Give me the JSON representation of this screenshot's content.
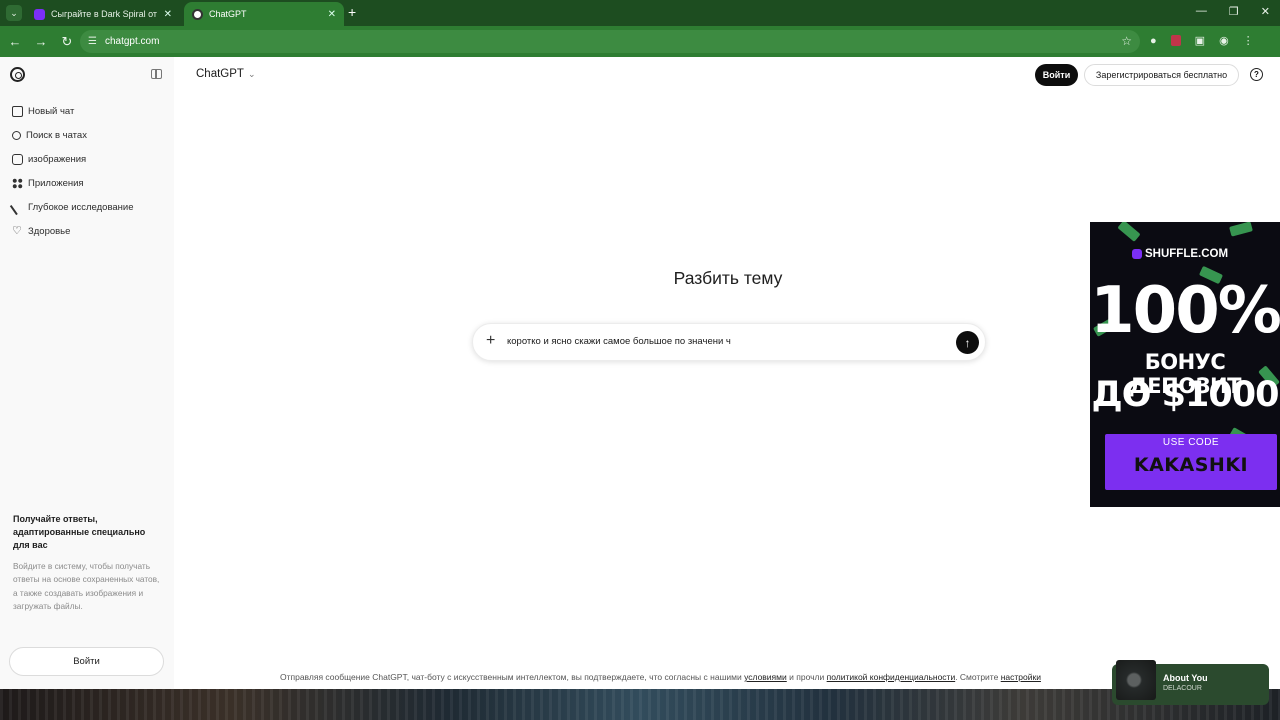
{
  "browser": {
    "tabs": [
      {
        "title": "Сыграйте в Dark Spiral от Hack"
      },
      {
        "title": "ChatGPT"
      }
    ],
    "url": "chatgpt.com"
  },
  "sidebar": {
    "items": [
      {
        "label": "Новый чат",
        "icon": "edit-icon"
      },
      {
        "label": "Поиск в чатах",
        "icon": "search-icon"
      },
      {
        "label": "изображения",
        "icon": "image-icon"
      },
      {
        "label": "Приложения",
        "icon": "apps-icon"
      },
      {
        "label": "Глубокое исследование",
        "icon": "telescope-icon"
      },
      {
        "label": "Здоровье",
        "icon": "heart-icon"
      }
    ],
    "promo_title": "Получайте ответы, адаптированные специально для вас",
    "promo_text": "Войдите в систему, чтобы получать ответы на основе сохраненных чатов, а также создавать изображения и загружать файлы.",
    "login_label": "Войти"
  },
  "header": {
    "brand": "ChatGPT",
    "login_label": "Войти",
    "signup_label": "Зарегистрироваться бесплатно",
    "help": "?"
  },
  "main": {
    "headline": "Разбить тему",
    "prompt_value": "коротко и ясно скажи самое большое по значени ч"
  },
  "footer": {
    "prefix": "Отправляя сообщение ChatGPT, чат-боту с искусственным интеллектом, вы подтверждаете, что согласны с нашими",
    "terms_link": "условиями",
    "middle": "и прочли",
    "privacy_link": "политикой конфиденциальности",
    "tail": ". Смотрите",
    "settings_link": "настройки"
  },
  "ad": {
    "brand": "SHUFFLE.COM",
    "big": "100%",
    "line1": "БОНУС ДЕПОЗИТ",
    "line2": "ДО $1000",
    "code_label": "USE CODE",
    "code": "KAKASHKI"
  },
  "now_playing": {
    "track": "About You",
    "artist": "DELACOUR"
  },
  "colors": {
    "browser_frame": "#1d4d20",
    "toolbar": "#2e7d32",
    "ad_accent": "#7c2ff0"
  }
}
